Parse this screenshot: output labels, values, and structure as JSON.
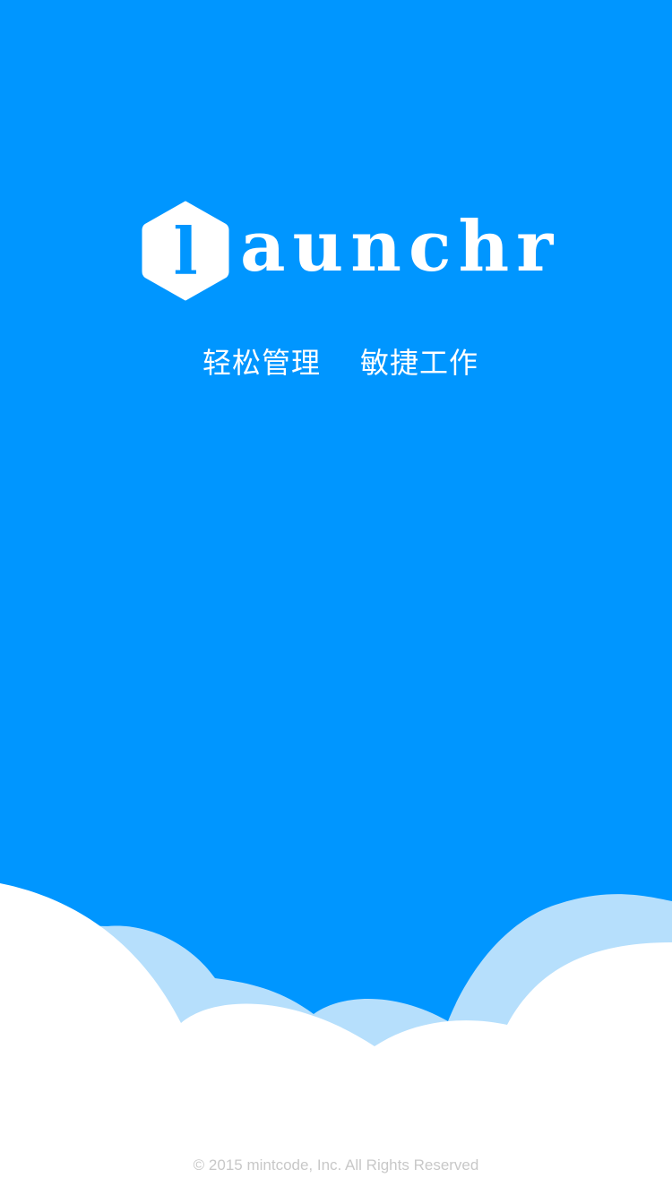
{
  "brand": {
    "logo_letter": "l",
    "wordmark": "aunchr",
    "icon": "hexagon-l-logo-icon"
  },
  "taglines": {
    "left": "轻松管理",
    "right": "敏捷工作"
  },
  "footer": {
    "copyright": "© 2015 mintcode, Inc. All Rights Reserved"
  },
  "colors": {
    "background": "#0096FF",
    "cloud_back": "#B6DFFC",
    "cloud_front": "#FFFFFF",
    "text": "#FFFFFF",
    "copyright_text": "#C8C8C8"
  }
}
